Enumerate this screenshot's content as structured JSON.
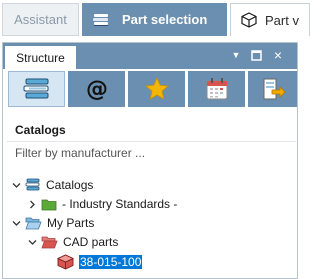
{
  "top_tabs": {
    "assistant": "Assistant",
    "part_selection": "Part selection",
    "part_view": "Part v"
  },
  "panel": {
    "structure_tab": "Structure",
    "controls": {
      "pin": "▼",
      "maximize": "□",
      "close": "×"
    }
  },
  "toolbar": {
    "buttons": [
      {
        "icon": "books-icon",
        "active": true
      },
      {
        "icon": "at-icon",
        "active": false
      },
      {
        "icon": "star-icon",
        "active": false
      },
      {
        "icon": "calendar-icon",
        "active": false
      },
      {
        "icon": "export-icon",
        "active": false
      }
    ]
  },
  "section_title": "Catalogs",
  "filter": {
    "placeholder": "Filter by manufacturer ..."
  },
  "tree": {
    "catalogs": "Catalogs",
    "industry_standards": "- Industry Standards -",
    "my_parts": "My Parts",
    "cad_parts": "CAD parts",
    "part_item": "38-015-100"
  },
  "colors": {
    "accent": "#6b8fb0",
    "toolbar_active": "#d7e6f3",
    "selection": "#0078d7",
    "folder_green": "#5aaa3a",
    "folder_red": "#d9534f",
    "star_gold": "#f2b705"
  }
}
